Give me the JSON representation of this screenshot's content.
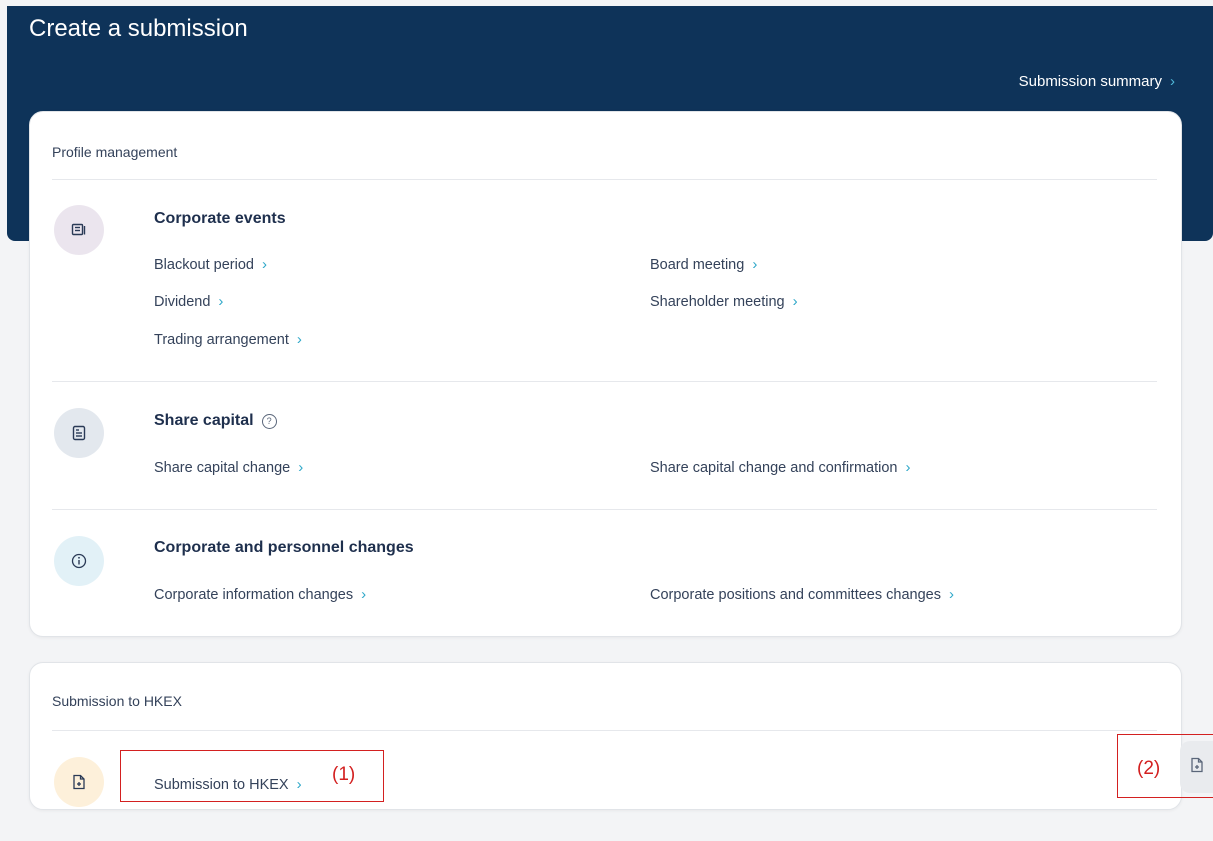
{
  "header": {
    "title": "Create a submission",
    "summary_link": "Submission summary",
    "chevron": "›"
  },
  "profile_card": {
    "title": "Profile management",
    "sections": [
      {
        "heading": "Corporate events",
        "icon": "news-icon",
        "icon_bg": "#ebe5ee",
        "links": [
          "Blackout period",
          "Board meeting",
          "Dividend",
          "Shareholder meeting",
          "Trading arrangement"
        ]
      },
      {
        "heading": "Share capital",
        "help_icon": "?",
        "icon": "document-icon",
        "icon_bg": "#e3e8ee",
        "links": [
          "Share capital change",
          "Share capital change and confirmation"
        ]
      },
      {
        "heading": "Corporate and personnel changes",
        "icon": "info-icon",
        "icon_bg": "#e2f1f7",
        "links": [
          "Corporate information changes",
          "Corporate positions and committees changes"
        ]
      }
    ]
  },
  "hkex_card": {
    "title": "Submission to HKEX",
    "icon": "file-plus-icon",
    "icon_bg": "#fdf0da",
    "link": "Submission to HKEX"
  },
  "annotations": {
    "label_1": "(1)",
    "label_2": "(2)",
    "color": "#d32020"
  },
  "colors": {
    "header_bg": "#0e3359",
    "accent": "#2fa8c9"
  }
}
